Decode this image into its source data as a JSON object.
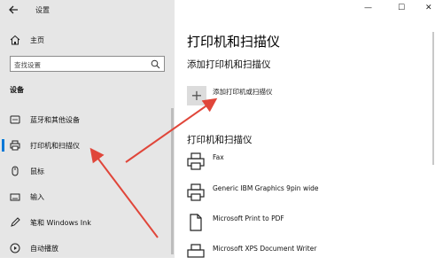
{
  "window": {
    "title": "设置",
    "minimize": "—",
    "maximize": "☐",
    "close": "✕"
  },
  "sidebar": {
    "home_label": "主页",
    "search_placeholder": "查找设置",
    "section_title": "设备",
    "items": [
      {
        "label": "蓝牙和其他设备",
        "icon": "bluetooth-icon"
      },
      {
        "label": "打印机和扫描仪",
        "icon": "printer-icon",
        "selected": true
      },
      {
        "label": "鼠标",
        "icon": "mouse-icon"
      },
      {
        "label": "输入",
        "icon": "keyboard-icon"
      },
      {
        "label": "笔和 Windows Ink",
        "icon": "pen-icon"
      },
      {
        "label": "自动播放",
        "icon": "autoplay-icon"
      }
    ]
  },
  "main": {
    "title": "打印机和扫描仪",
    "add_section_title": "添加打印机和扫描仪",
    "add_button_label": "添加打印机或扫描仪",
    "list_title": "打印机和扫描仪",
    "printers": [
      {
        "name": "Fax",
        "icon": "fax-icon"
      },
      {
        "name": "Generic IBM Graphics 9pin wide",
        "icon": "printer-icon"
      },
      {
        "name": "Microsoft Print to PDF",
        "icon": "document-printer-icon"
      },
      {
        "name": "Microsoft XPS Document Writer",
        "icon": "printer-icon"
      }
    ]
  },
  "colors": {
    "sidebar_bg": "#e6e6e6",
    "accent": "#0078d7",
    "annotation_arrow": "#e0463a"
  }
}
